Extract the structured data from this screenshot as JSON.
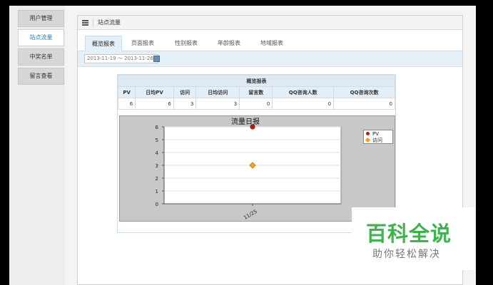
{
  "sidebar": {
    "items": [
      {
        "label": "用户管理",
        "active": false
      },
      {
        "label": "站点流量",
        "active": true
      },
      {
        "label": "中奖名单",
        "active": false
      },
      {
        "label": "留言查看",
        "active": false
      }
    ]
  },
  "header": {
    "title": "站点流量"
  },
  "tabs": [
    {
      "label": "概览报表",
      "active": true
    },
    {
      "label": "页面报表",
      "active": false
    },
    {
      "label": "性别报表",
      "active": false
    },
    {
      "label": "年龄报表",
      "active": false
    },
    {
      "label": "地域报表",
      "active": false
    }
  ],
  "date_range": {
    "value": "2013-11-19 ～ 2013-11-26"
  },
  "summary_table": {
    "caption": "概览报表",
    "columns": [
      "PV",
      "日均PV",
      "访问",
      "日均访问",
      "留言数",
      "QQ咨询人数",
      "QQ咨询次数"
    ],
    "values": [
      "6",
      "6",
      "3",
      "3",
      "0",
      "0",
      "0"
    ]
  },
  "chart_data": {
    "type": "scatter",
    "title": "流量日报",
    "categories": [
      "11/25"
    ],
    "ylim": [
      0,
      6
    ],
    "yticks": [
      0,
      1,
      2,
      3,
      4,
      5,
      6
    ],
    "grid": true,
    "legend_position": "top-right",
    "series": [
      {
        "name": "PV",
        "values": [
          6
        ],
        "color": "#cc1111",
        "marker": "circle"
      },
      {
        "name": "访问",
        "values": [
          3
        ],
        "color": "#f0a020",
        "marker": "diamond"
      }
    ]
  },
  "watermark": {
    "main": "百科全说",
    "sub": "助你轻松解决"
  },
  "colors": {
    "accent": "#2a7fbf",
    "tab_bg": "#e4f0f8",
    "brand_green": "#3bb54a"
  }
}
